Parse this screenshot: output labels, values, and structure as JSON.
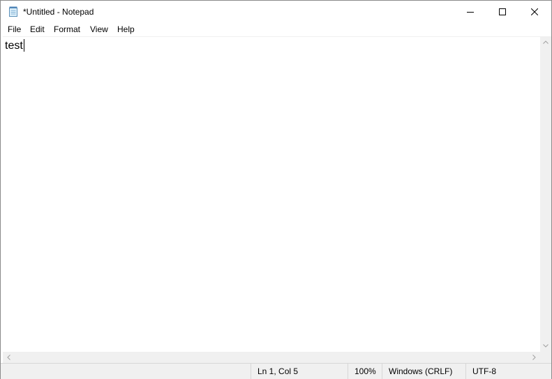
{
  "window": {
    "title": "*Untitled - Notepad"
  },
  "icons": {
    "app": "notepad-icon",
    "minimize": "minimize-icon",
    "maximize": "maximize-icon",
    "close": "close-icon"
  },
  "menu": {
    "items": [
      {
        "label": "File"
      },
      {
        "label": "Edit"
      },
      {
        "label": "Format"
      },
      {
        "label": "View"
      },
      {
        "label": "Help"
      }
    ]
  },
  "editor": {
    "content": "test"
  },
  "status": {
    "position": "Ln 1, Col 5",
    "zoom": "100%",
    "line_ending": "Windows (CRLF)",
    "encoding": "UTF-8"
  },
  "colors": {
    "chrome": "#f0f0f0",
    "border": "#d7d7d7",
    "text": "#000000"
  }
}
